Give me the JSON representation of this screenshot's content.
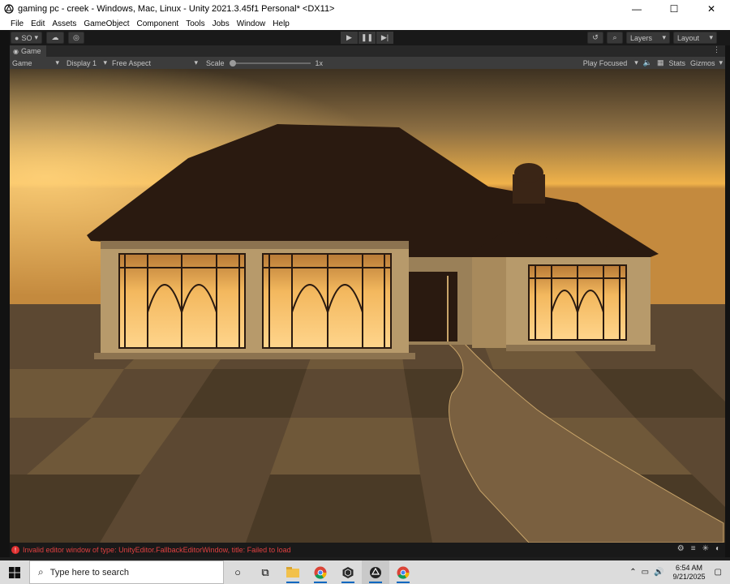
{
  "window": {
    "title": "gaming pc - creek - Windows, Mac, Linux - Unity 2021.3.45f1 Personal* <DX11>",
    "minimize": "—",
    "maximize": "☐",
    "close": "✕"
  },
  "menu": [
    "File",
    "Edit",
    "Assets",
    "GameObject",
    "Component",
    "Tools",
    "Jobs",
    "Window",
    "Help"
  ],
  "toolbar": {
    "account_label": "SO",
    "layers_label": "Layers",
    "layout_label": "Layout"
  },
  "tab": {
    "label": "Game"
  },
  "game_toolbar": {
    "view_mode": "Game",
    "display": "Display 1",
    "aspect": "Free Aspect",
    "scale_label": "Scale",
    "scale_value": "1x",
    "scale_fraction": 0.0,
    "play_mode": "Play Focused",
    "stats_label": "Stats",
    "gizmos_label": "Gizmos"
  },
  "status": {
    "error_message": "Invalid editor window of type: UnityEditor.FallbackEditorWindow, title: Failed to load"
  },
  "taskbar": {
    "search_placeholder": "Type here to search",
    "time": "6:54 AM",
    "date": "9/21/2025"
  },
  "colors": {
    "sky_top": "#5a4a33",
    "sky_horizon": "#f0b24a",
    "roof": "#2a1a10",
    "wall": "#b79a6b",
    "window_glow": "#f3b85e",
    "error_red": "#e04040"
  }
}
